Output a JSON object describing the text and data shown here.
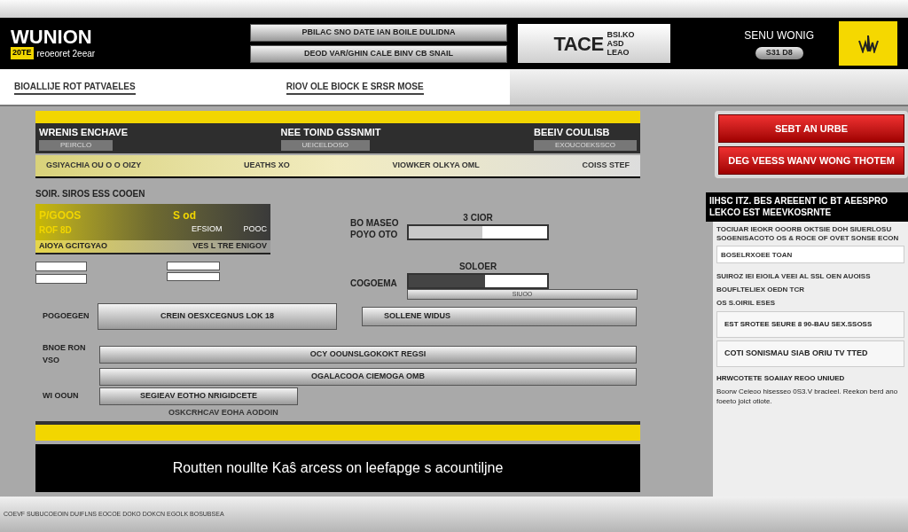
{
  "header": {
    "logo": "WUNION",
    "logo_tag": "20TE",
    "logo_subtitle": "reoeoret 2eear",
    "actions": [
      "PBILAC SNO DATE IAN BOILE DULIDNA",
      "DEOD VAR/GHIN CALE BINV CB SNAIL"
    ],
    "brand": {
      "title": "TACE",
      "small": [
        "BSI.KO",
        "ASD",
        "LEAO"
      ]
    },
    "user": {
      "name": "SENU WONIG",
      "badge": "S31 D8"
    }
  },
  "nav_links": [
    "BIOALLIJE ROT PATVAELES",
    "RIOV OLE BIOCK E SRSR MOSE"
  ],
  "panel": {
    "columns": [
      {
        "title": "WRENIS ENCHAVE",
        "sub": "PEIRCLO"
      },
      {
        "title": "NEE TOIND GSSNMIT",
        "sub": "UEICELDOSO"
      },
      {
        "title": "BEEIV COULISB",
        "sub": "EXOUCOEKSSCO"
      }
    ],
    "summary": [
      "GSIYACHIA OU O O OIZY",
      "UEATHS XO",
      "VIOWKER OLKYA OML",
      "COISS STEF"
    ],
    "section_label": "SOIR. SIROS ESS COOEN",
    "card": {
      "code": "P/GOOS",
      "value": "S od",
      "line": "ROF 8D",
      "status": "EFSIOM",
      "amount": "POOC",
      "footer_left": "AIOYA GCITGYAO",
      "footer_right": "VES L TRE ENIGOV"
    },
    "meters": [
      {
        "label": "BO MASEO POYO OTO",
        "caption": "3 CIOR",
        "level": 0.53
      },
      {
        "label": "COGOEMA",
        "caption": "SOLOER",
        "level": 0.55
      }
    ],
    "sub_bar": "SIUOO",
    "side_button": "SOLLENE WIDUS",
    "rows": [
      {
        "label": "POGOEGEN",
        "button": "CREIN OESXCEGNUS LOK 18"
      },
      {
        "label": "BNOE RON VSO",
        "button": "OCY OOUNSLGOKOKT REGSI"
      },
      {
        "button": "OGALACOOA CIEMOGA OMB"
      },
      {
        "label": "WI OOUN",
        "button": "SEGIEAV EOTHO NRIGIDCETE"
      }
    ],
    "rows_note": "OSKCRHCAV EOHA AODOIN",
    "banner": "Routten noullte Kaŝ arcess on leefapge s acountiljne"
  },
  "sidebar": {
    "buttons": [
      "SEBT AN URBE",
      "DEG VEESS WANV WONG THOTEM"
    ],
    "notice": "IIHSC ITZ. BES AREEENT IC BT AEESPRO LEKCO EST MEEVKOSRNTE",
    "intro": "TOCIUAR IEOKR OOORB OKTSIE DOH SIUERLOSU SOGENISACOTO OS & ROCE OF OVET SONSE ECON",
    "field_value": "BOSELRXOEE TOAN",
    "heading": "SUIROZ IEI EIOILA VEEI AL SSL OEN AUOISS",
    "lines": [
      "BOUFLTELIEX OEDN TCR",
      "OS S.OIRIL ESES"
    ],
    "list": [
      "EST SROTEE SEURE 8 90-BAU SEX.SSOSS",
      "COTI SONISMAU SIAB ORIU TV TTED"
    ],
    "note_title": "HRWCOTETE SOAIIAY REOO UNIUED",
    "note_text": "Boorw Ceieoo hisesseo 0S3.V bracieel. Reekon berd ano foeeto joict otiote."
  },
  "footer": "COEVF SUBUCOEOIN DUIFLNS EOCOE DOKO DOKCN EGOLK BOSUBSEA"
}
